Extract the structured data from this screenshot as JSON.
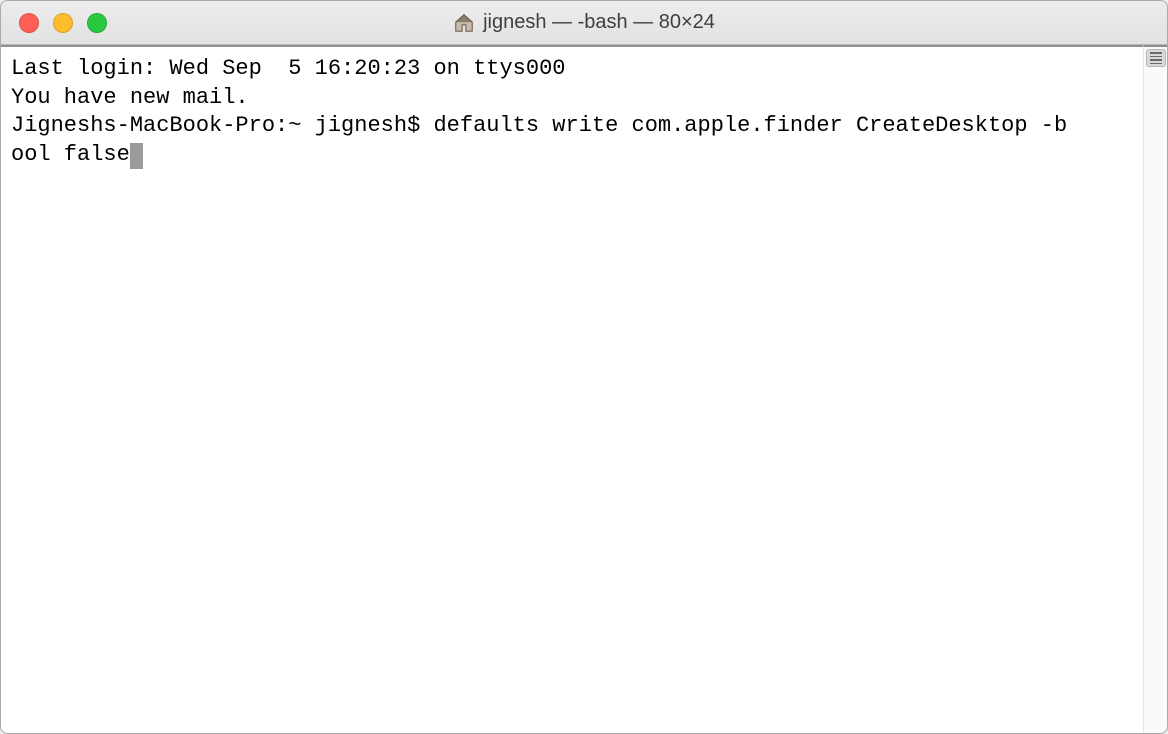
{
  "titlebar": {
    "title": "jignesh — -bash — 80×24"
  },
  "terminal": {
    "lines": {
      "l0": "Last login: Wed Sep  5 16:20:23 on ttys000",
      "l1": "You have new mail.",
      "prompt": "Jigneshs-MacBook-Pro:~ jignesh$ ",
      "command_part1": "defaults write com.apple.finder CreateDesktop -b",
      "command_part2": "ool false"
    }
  }
}
